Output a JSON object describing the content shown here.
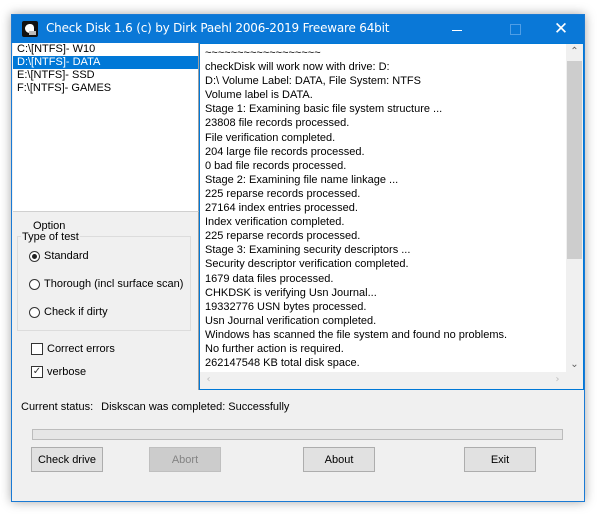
{
  "window": {
    "title": "Check Disk 1.6 (c) by Dirk Paehl  2006-2019 Freeware 64bit",
    "close_glyph": "✕"
  },
  "drives": {
    "items": [
      {
        "label": "C:\\[NTFS]- W10",
        "selected": false
      },
      {
        "label": "D:\\[NTFS]- DATA",
        "selected": true
      },
      {
        "label": "E:\\[NTFS]- SSD",
        "selected": false
      },
      {
        "label": "F:\\[NTFS]- GAMES",
        "selected": false
      }
    ]
  },
  "options": {
    "section_label": "Option",
    "group_title": "Type of test",
    "radios": [
      {
        "label": "Standard",
        "checked": true
      },
      {
        "label": "Thorough (incl surface scan)",
        "checked": false
      },
      {
        "label": "Check if dirty",
        "checked": false
      }
    ],
    "checkboxes": [
      {
        "label": "Correct errors",
        "checked": false
      },
      {
        "label": "verbose",
        "checked": true
      }
    ]
  },
  "log": {
    "lines": [
      "~~~~~~~~~~~~~~~~~~",
      "checkDisk will work now with drive: D:",
      "D:\\ Volume Label: DATA, File System: NTFS",
      "Volume label is DATA.",
      "Stage 1: Examining basic file system structure ...",
      "23808 file records processed.",
      "File verification completed.",
      "204 large file records processed.",
      "0 bad file records processed.",
      "Stage 2: Examining file name linkage ...",
      "225 reparse records processed.",
      "27164 index entries processed.",
      "Index verification completed.",
      "225 reparse records processed.",
      "Stage 3: Examining security descriptors ...",
      "Security descriptor verification completed.",
      "1679 data files processed.",
      "CHKDSK is verifying Usn Journal...",
      "19332776 USN bytes processed.",
      "Usn Journal verification completed.",
      "Windows has scanned the file system and found no problems.",
      "No further action is required.",
      "262147548 KB total disk space."
    ]
  },
  "status": {
    "label": "Current status:",
    "value": "Diskscan was completed: Successfully"
  },
  "progress": {
    "value_percent": 0
  },
  "buttons": {
    "check_drive": "Check drive",
    "abort": "Abort",
    "about": "About",
    "exit": "Exit"
  }
}
